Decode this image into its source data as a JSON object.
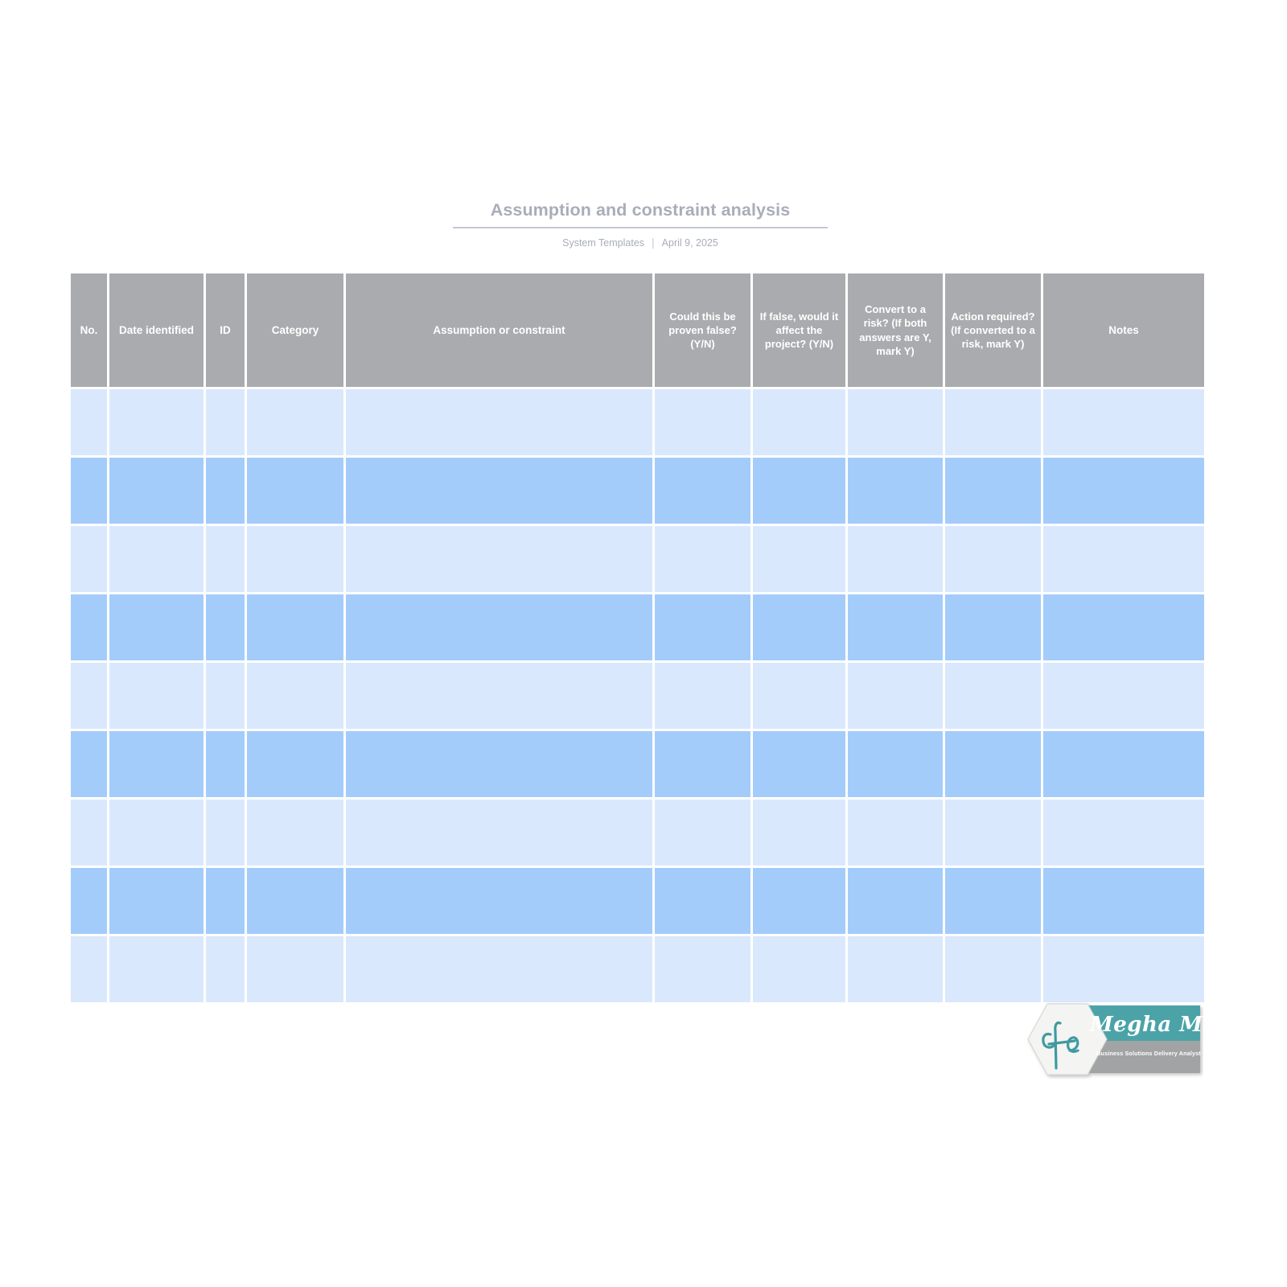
{
  "document": {
    "title": "Assumption and constraint analysis",
    "subtitle_source": "System Templates",
    "subtitle_separator": "|",
    "subtitle_date": "April 9, 2025"
  },
  "colors": {
    "page_background": "#ffffff",
    "title_text": "#a9adb8",
    "title_rule": "#c3c8d2",
    "header_fill": "#a9abae",
    "header_text": "#ffffff",
    "row_light": "#d9e8fc",
    "row_dark": "#a3ccfb",
    "logo_teal": "#4ba3a8",
    "logo_gray": "#a2a3a5"
  },
  "table": {
    "columns": [
      {
        "key": "no",
        "label": "No."
      },
      {
        "key": "date",
        "label": "Date identified"
      },
      {
        "key": "id",
        "label": "ID"
      },
      {
        "key": "category",
        "label": "Category"
      },
      {
        "key": "assumption",
        "label": "Assumption or constraint"
      },
      {
        "key": "false",
        "label": "Could this be proven false? (Y/N)"
      },
      {
        "key": "affect",
        "label": "If false, would it affect the project? (Y/N)"
      },
      {
        "key": "convert",
        "label": "Convert to a risk? (If both answers are Y, mark Y)"
      },
      {
        "key": "action",
        "label": "Action required? (If converted to a risk, mark Y)"
      },
      {
        "key": "notes",
        "label": "Notes"
      }
    ],
    "row_count": 9,
    "rows": [
      {
        "shade": "light",
        "cells": [
          "",
          "",
          "",
          "",
          "",
          "",
          "",
          "",
          "",
          ""
        ]
      },
      {
        "shade": "dark",
        "cells": [
          "",
          "",
          "",
          "",
          "",
          "",
          "",
          "",
          "",
          ""
        ]
      },
      {
        "shade": "light",
        "cells": [
          "",
          "",
          "",
          "",
          "",
          "",
          "",
          "",
          "",
          ""
        ]
      },
      {
        "shade": "dark",
        "cells": [
          "",
          "",
          "",
          "",
          "",
          "",
          "",
          "",
          "",
          ""
        ]
      },
      {
        "shade": "light",
        "cells": [
          "",
          "",
          "",
          "",
          "",
          "",
          "",
          "",
          "",
          ""
        ]
      },
      {
        "shade": "dark",
        "cells": [
          "",
          "",
          "",
          "",
          "",
          "",
          "",
          "",
          "",
          ""
        ]
      },
      {
        "shade": "light",
        "cells": [
          "",
          "",
          "",
          "",
          "",
          "",
          "",
          "",
          "",
          ""
        ]
      },
      {
        "shade": "dark",
        "cells": [
          "",
          "",
          "",
          "",
          "",
          "",
          "",
          "",
          "",
          ""
        ]
      },
      {
        "shade": "light",
        "cells": [
          "",
          "",
          "",
          "",
          "",
          "",
          "",
          "",
          "",
          ""
        ]
      }
    ]
  },
  "logo": {
    "name": "Megha M.",
    "tagline": "Business Solutions Delivery Analyst",
    "monogram": "cfe-monogram"
  }
}
